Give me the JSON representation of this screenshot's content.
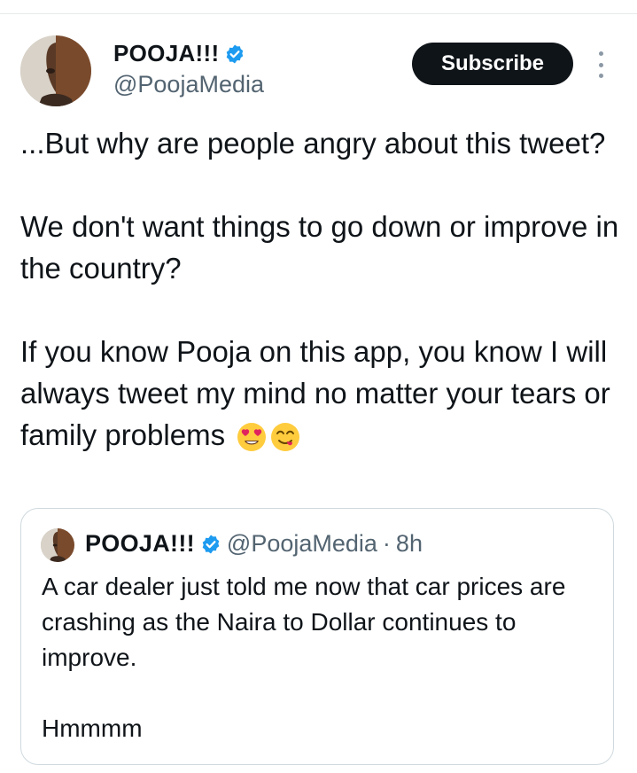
{
  "author": {
    "display_name": "POOJA!!!",
    "handle": "@PoojaMedia",
    "verified": true,
    "avatar_icon": "profile-photo"
  },
  "actions": {
    "subscribe_label": "Subscribe",
    "more_icon": "more-vertical-icon"
  },
  "tweet": {
    "lines": [
      "...But why are people angry about this tweet?",
      "We don't want things to go down or improve in the country?",
      "If you know Pooja on this app, you know I will always tweet my mind no matter your tears or family problems"
    ],
    "emojis": [
      "heart-eyes-emoji",
      "savoring-food-emoji"
    ]
  },
  "quoted_tweet": {
    "display_name": "POOJA!!!",
    "handle": "@PoojaMedia",
    "separator": "·",
    "time": "8h",
    "lines": [
      "A car dealer just told me now that car prices are crashing as the Naira to Dollar continues to improve.",
      "Hmmmm"
    ]
  },
  "colors": {
    "text": "#0f1419",
    "secondary": "#536471",
    "verified_blue": "#1d9bf0",
    "button_bg": "#0f1419",
    "border": "#cfd9de"
  }
}
